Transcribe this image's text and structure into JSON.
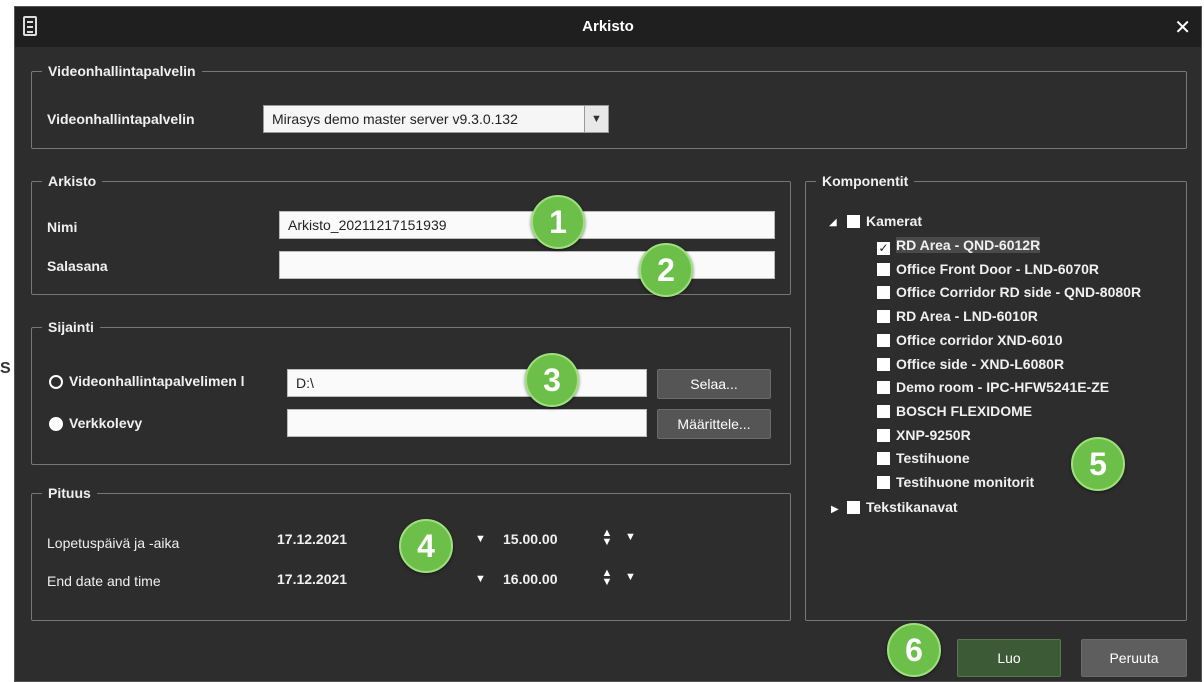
{
  "window": {
    "title": "Arkisto",
    "icon": "app-icon",
    "close_icon": "close-icon"
  },
  "server_group": {
    "legend": "Videonhallintapalvelin",
    "label": "Videonhallintapalvelin",
    "selected": "Mirasys demo master server v9.3.0.132",
    "dropdown_icon": "chevron-down-icon"
  },
  "archive_group": {
    "legend": "Arkisto",
    "name_label": "Nimi",
    "name_value": "Arkisto_20211217151939",
    "password_label": "Salasana",
    "password_value": ""
  },
  "location_group": {
    "legend": "Sijainti",
    "option1_label": "Videonhallintapalvelimen l",
    "option1_value": "D:\\",
    "option1_selected": false,
    "browse_label": "Selaa...",
    "option2_label": "Verkkolevy",
    "option2_value": "",
    "option2_selected": true,
    "define_label": "Määrittele..."
  },
  "duration_group": {
    "legend": "Pituus",
    "start_label": "Lopetuspäivä ja -aika",
    "start_date": "17.12.2021",
    "start_time": "15.00.00",
    "end_label": "End date and time",
    "end_date": "17.12.2021",
    "end_time": "16.00.00"
  },
  "components": {
    "legend": "Komponentit",
    "cameras_label": "Kamerat",
    "cameras": [
      {
        "label": "RD Area - QND-6012R",
        "checked": true
      },
      {
        "label": "Office Front Door - LND-6070R",
        "checked": false
      },
      {
        "label": "Office Corridor RD side - QND-8080R",
        "checked": false
      },
      {
        "label": "RD Area - LND-6010R",
        "checked": false
      },
      {
        "label": "Office corridor XND-6010",
        "checked": false
      },
      {
        "label": "Office side - XND-L6080R",
        "checked": false
      },
      {
        "label": "Demo room - IPC-HFW5241E-ZE",
        "checked": false
      },
      {
        "label": "BOSCH FLEXIDOME",
        "checked": false
      },
      {
        "label": "XNP-9250R",
        "checked": false
      },
      {
        "label": "Testihuone",
        "checked": false
      },
      {
        "label": "Testihuone monitorit",
        "checked": false
      }
    ],
    "text_channels_label": "Tekstikanavat"
  },
  "buttons": {
    "create": "Luo",
    "cancel": "Peruuta"
  },
  "callouts": [
    "1",
    "2",
    "3",
    "4",
    "5",
    "6"
  ],
  "colors": {
    "dialog_bg": "#2d2d2d",
    "titlebar_bg": "#1f1f1f",
    "callout": "#6cc04a",
    "create_button": "#3d5a37"
  }
}
